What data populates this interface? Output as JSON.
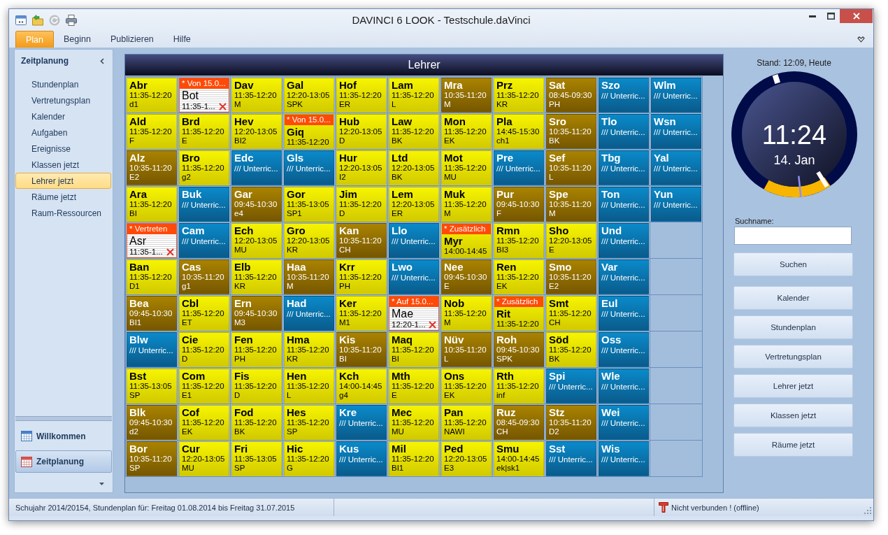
{
  "window": {
    "title": "DAVINCI 6 LOOK - Testschule.daVinci"
  },
  "quick_access": [
    {
      "kind": "window",
      "disabled": false
    },
    {
      "kind": "folder",
      "disabled": false
    },
    {
      "kind": "refresh",
      "disabled": true
    },
    {
      "kind": "printer",
      "disabled": false
    }
  ],
  "ribbon_tabs": [
    {
      "label": "Plan",
      "selected": true
    },
    {
      "label": "Beginn",
      "selected": false
    },
    {
      "label": "Publizieren",
      "selected": false
    },
    {
      "label": "Hilfe",
      "selected": false
    }
  ],
  "sidebar": {
    "title": "Zeitplanung",
    "items": [
      {
        "label": "Stundenplan",
        "selected": false
      },
      {
        "label": "Vertretungsplan",
        "selected": false
      },
      {
        "label": "Kalender",
        "selected": false
      },
      {
        "label": "Aufgaben",
        "selected": false
      },
      {
        "label": "Ereignisse",
        "selected": false
      },
      {
        "label": "Klassen jetzt",
        "selected": false
      },
      {
        "label": "Lehrer jetzt",
        "selected": true
      },
      {
        "label": "Räume jetzt",
        "selected": false
      },
      {
        "label": "Raum-Ressourcen",
        "selected": false
      }
    ],
    "nav_buttons": [
      {
        "kind": "calendar",
        "label": "Willkommen",
        "selected": false
      },
      {
        "kind": "timetable",
        "label": "Zeitplanung",
        "selected": true
      }
    ]
  },
  "board": {
    "title": "Lehrer",
    "rows": [
      [
        {
          "kind": "lesson",
          "name": "Abr",
          "time": "11:35-12:20",
          "subject": "d1"
        },
        {
          "kind": "cancelled",
          "banner": "* Von 15.0...",
          "name": "Bot",
          "time": "11:35-1..."
        },
        {
          "kind": "lesson",
          "name": "Dav",
          "time": "11:35-12:20",
          "subject": "M"
        },
        {
          "kind": "lesson",
          "name": "Gal",
          "time": "12:20-13:05",
          "subject": "SPK"
        },
        {
          "kind": "lesson",
          "name": "Hof",
          "time": "11:35-12:20",
          "subject": "ER"
        },
        {
          "kind": "lesson",
          "name": "Lam",
          "time": "11:35-12:20",
          "subject": "L"
        },
        {
          "kind": "past",
          "name": "Mra",
          "time": "10:35-11:20",
          "subject": "M"
        },
        {
          "kind": "lesson",
          "name": "Prz",
          "time": "11:35-12:20",
          "subject": "KR"
        },
        {
          "kind": "past",
          "name": "Sat",
          "time": "08:45-09:30",
          "subject": "PH"
        },
        {
          "kind": "free",
          "name": "Szo",
          "note": "/// Unterric..."
        },
        {
          "kind": "free",
          "name": "Wlm",
          "note": "/// Unterric..."
        }
      ],
      [
        {
          "kind": "lesson",
          "name": "Ald",
          "time": "11:35-12:20",
          "subject": "F"
        },
        {
          "kind": "lesson",
          "name": "Brd",
          "time": "11:35-12:20",
          "subject": "E"
        },
        {
          "kind": "lesson",
          "name": "Hev",
          "time": "12:20-13:05",
          "subject": "BI2"
        },
        {
          "kind": "lesson",
          "banner": "* Von 15.0...",
          "name": "Giq",
          "time": "11:35-12:20"
        },
        {
          "kind": "lesson",
          "name": "Hub",
          "time": "12:20-13:05",
          "subject": "D"
        },
        {
          "kind": "lesson",
          "name": "Law",
          "time": "11:35-12:20",
          "subject": "BK"
        },
        {
          "kind": "lesson",
          "name": "Mon",
          "time": "11:35-12:20",
          "subject": "EK"
        },
        {
          "kind": "lesson",
          "name": "Pla",
          "time": "14:45-15:30",
          "subject": "ch1"
        },
        {
          "kind": "past",
          "name": "Sro",
          "time": "10:35-11:20",
          "subject": "BK"
        },
        {
          "kind": "free",
          "name": "Tlo",
          "note": "/// Unterric..."
        },
        {
          "kind": "free",
          "name": "Wsn",
          "note": "/// Unterric..."
        }
      ],
      [
        {
          "kind": "past",
          "name": "Alz",
          "time": "10:35-11:20",
          "subject": "E2"
        },
        {
          "kind": "lesson",
          "name": "Bro",
          "time": "11:35-12:20",
          "subject": "g2"
        },
        {
          "kind": "free",
          "name": "Edc",
          "note": "/// Unterric..."
        },
        {
          "kind": "free",
          "name": "Gls",
          "note": "/// Unterric..."
        },
        {
          "kind": "lesson",
          "name": "Hur",
          "time": "12:20-13:05",
          "subject": "I2"
        },
        {
          "kind": "lesson",
          "name": "Ltd",
          "time": "12:20-13:05",
          "subject": "BK"
        },
        {
          "kind": "lesson",
          "name": "Mot",
          "time": "11:35-12:20",
          "subject": "MU"
        },
        {
          "kind": "free",
          "name": "Pre",
          "note": "/// Unterric..."
        },
        {
          "kind": "past",
          "name": "Sef",
          "time": "10:35-11:20",
          "subject": "L"
        },
        {
          "kind": "free",
          "name": "Tbg",
          "note": "/// Unterric..."
        },
        {
          "kind": "free",
          "name": "Yal",
          "note": "/// Unterric..."
        }
      ],
      [
        {
          "kind": "lesson",
          "name": "Ara",
          "time": "11:35-12:20",
          "subject": "BI"
        },
        {
          "kind": "free",
          "name": "Buk",
          "note": "/// Unterric..."
        },
        {
          "kind": "past",
          "name": "Gar",
          "time": "09:45-10:30",
          "subject": "e4"
        },
        {
          "kind": "lesson",
          "name": "Gor",
          "time": "11:35-13:05",
          "subject": "SP1"
        },
        {
          "kind": "lesson",
          "name": "Jim",
          "time": "11:35-12:20",
          "subject": "D"
        },
        {
          "kind": "lesson",
          "name": "Lem",
          "time": "12:20-13:05",
          "subject": "ER"
        },
        {
          "kind": "lesson",
          "name": "Muk",
          "time": "11:35-12:20",
          "subject": "M"
        },
        {
          "kind": "past",
          "name": "Pur",
          "time": "09:45-10:30",
          "subject": "F"
        },
        {
          "kind": "past",
          "name": "Spe",
          "time": "10:35-11:20",
          "subject": "M"
        },
        {
          "kind": "free",
          "name": "Ton",
          "note": "/// Unterric..."
        },
        {
          "kind": "free",
          "name": "Yun",
          "note": "/// Unterric..."
        }
      ],
      [
        {
          "kind": "cancelled",
          "banner": "* Vertreten",
          "name": "Asr",
          "time": "11:35-1..."
        },
        {
          "kind": "free",
          "name": "Cam",
          "note": "/// Unterric..."
        },
        {
          "kind": "lesson",
          "name": "Ech",
          "time": "12:20-13:05",
          "subject": "MU"
        },
        {
          "kind": "lesson",
          "name": "Gro",
          "time": "12:20-13:05",
          "subject": "KR"
        },
        {
          "kind": "past",
          "name": "Kan",
          "time": "10:35-11:20",
          "subject": "CH"
        },
        {
          "kind": "free",
          "name": "Llo",
          "note": "/// Unterric..."
        },
        {
          "kind": "lesson",
          "banner": "* Zusätzlich",
          "name": "Myr",
          "time": "14:00-14:45"
        },
        {
          "kind": "lesson",
          "name": "Rmn",
          "time": "11:35-12:20",
          "subject": "BI3"
        },
        {
          "kind": "lesson",
          "name": "Sho",
          "time": "12:20-13:05",
          "subject": "E"
        },
        {
          "kind": "free",
          "name": "Und",
          "note": "/// Unterric..."
        }
      ],
      [
        {
          "kind": "lesson",
          "name": "Ban",
          "time": "11:35-12:20",
          "subject": "D1"
        },
        {
          "kind": "past",
          "name": "Cas",
          "time": "10:35-11:20",
          "subject": "g1"
        },
        {
          "kind": "lesson",
          "name": "Elb",
          "time": "11:35-12:20",
          "subject": "KR"
        },
        {
          "kind": "past",
          "name": "Haa",
          "time": "10:35-11:20",
          "subject": "M"
        },
        {
          "kind": "lesson",
          "name": "Krr",
          "time": "11:35-12:20",
          "subject": "PH"
        },
        {
          "kind": "free",
          "name": "Lwo",
          "note": "/// Unterric..."
        },
        {
          "kind": "past",
          "name": "Nee",
          "time": "09:45-10:30",
          "subject": "E"
        },
        {
          "kind": "lesson",
          "name": "Ren",
          "time": "11:35-12:20",
          "subject": "EK"
        },
        {
          "kind": "past",
          "name": "Smo",
          "time": "10:35-11:20",
          "subject": "E2"
        },
        {
          "kind": "free",
          "name": "Var",
          "note": "/// Unterric..."
        }
      ],
      [
        {
          "kind": "past",
          "name": "Bea",
          "time": "09:45-10:30",
          "subject": "BI1"
        },
        {
          "kind": "lesson",
          "name": "Cbl",
          "time": "11:35-12:20",
          "subject": "ET"
        },
        {
          "kind": "past",
          "name": "Ern",
          "time": "09:45-10:30",
          "subject": "M3"
        },
        {
          "kind": "free",
          "name": "Had",
          "note": "/// Unterric..."
        },
        {
          "kind": "lesson",
          "name": "Ker",
          "time": "11:35-12:20",
          "subject": "M1"
        },
        {
          "kind": "cancelled",
          "banner": "* Auf 15.0...",
          "name": "Mae",
          "time": "12:20-1..."
        },
        {
          "kind": "lesson",
          "name": "Nob",
          "time": "11:35-12:20",
          "subject": "M"
        },
        {
          "kind": "lesson",
          "banner": "* Zusätzlich",
          "name": "Rit",
          "time": "11:35-12:20"
        },
        {
          "kind": "lesson",
          "name": "Smt",
          "time": "11:35-12:20",
          "subject": "CH"
        },
        {
          "kind": "free",
          "name": "Eul",
          "note": "/// Unterric..."
        }
      ],
      [
        {
          "kind": "free",
          "name": "Blw",
          "note": "/// Unterric..."
        },
        {
          "kind": "lesson",
          "name": "Cie",
          "time": "11:35-12:20",
          "subject": "D"
        },
        {
          "kind": "lesson",
          "name": "Fen",
          "time": "11:35-12:20",
          "subject": "PH"
        },
        {
          "kind": "lesson",
          "name": "Hma",
          "time": "11:35-12:20",
          "subject": "KR"
        },
        {
          "kind": "past",
          "name": "Kis",
          "time": "10:35-11:20",
          "subject": "BI"
        },
        {
          "kind": "lesson",
          "name": "Maq",
          "time": "11:35-12:20",
          "subject": "BI"
        },
        {
          "kind": "past",
          "name": "Nüv",
          "time": "10:35-11:20",
          "subject": "L"
        },
        {
          "kind": "past",
          "name": "Roh",
          "time": "09:45-10:30",
          "subject": "SPK"
        },
        {
          "kind": "lesson",
          "name": "Söd",
          "time": "11:35-12:20",
          "subject": "BK"
        },
        {
          "kind": "free",
          "name": "Oss",
          "note": "/// Unterric..."
        }
      ],
      [
        {
          "kind": "lesson",
          "name": "Bst",
          "time": "11:35-13:05",
          "subject": "SP"
        },
        {
          "kind": "lesson",
          "name": "Com",
          "time": "11:35-12:20",
          "subject": "E1"
        },
        {
          "kind": "lesson",
          "name": "Fis",
          "time": "11:35-12:20",
          "subject": "D"
        },
        {
          "kind": "lesson",
          "name": "Hen",
          "time": "11:35-12:20",
          "subject": "L"
        },
        {
          "kind": "lesson",
          "name": "Kch",
          "time": "14:00-14:45",
          "subject": "g4"
        },
        {
          "kind": "lesson",
          "name": "Mth",
          "time": "11:35-12:20",
          "subject": "E"
        },
        {
          "kind": "lesson",
          "name": "Ons",
          "time": "11:35-12:20",
          "subject": "EK"
        },
        {
          "kind": "lesson",
          "name": "Rth",
          "time": "11:35-12:20",
          "subject": "inf"
        },
        {
          "kind": "free",
          "name": "Spi",
          "note": "/// Unterric..."
        },
        {
          "kind": "free",
          "name": "Wle",
          "note": "/// Unterric..."
        }
      ],
      [
        {
          "kind": "past",
          "name": "Blk",
          "time": "09:45-10:30",
          "subject": "d2"
        },
        {
          "kind": "lesson",
          "name": "Cof",
          "time": "11:35-12:20",
          "subject": "EK"
        },
        {
          "kind": "lesson",
          "name": "Fod",
          "time": "11:35-12:20",
          "subject": "BK"
        },
        {
          "kind": "lesson",
          "name": "Hes",
          "time": "11:35-12:20",
          "subject": "SP"
        },
        {
          "kind": "free",
          "name": "Kre",
          "note": "/// Unterric..."
        },
        {
          "kind": "lesson",
          "name": "Mec",
          "time": "11:35-12:20",
          "subject": "MU"
        },
        {
          "kind": "lesson",
          "name": "Pan",
          "time": "11:35-12:20",
          "subject": "NAWI"
        },
        {
          "kind": "past",
          "name": "Ruz",
          "time": "08:45-09:30",
          "subject": "CH"
        },
        {
          "kind": "past",
          "name": "Stz",
          "time": "10:35-11:20",
          "subject": "D2"
        },
        {
          "kind": "free",
          "name": "Wei",
          "note": "/// Unterric..."
        }
      ],
      [
        {
          "kind": "past",
          "name": "Bor",
          "time": "10:35-11:20",
          "subject": "SP"
        },
        {
          "kind": "lesson",
          "name": "Cur",
          "time": "12:20-13:05",
          "subject": "MU"
        },
        {
          "kind": "lesson",
          "name": "Fri",
          "time": "11:35-13:05",
          "subject": "SP"
        },
        {
          "kind": "lesson",
          "name": "Hic",
          "time": "11:35-12:20",
          "subject": "G"
        },
        {
          "kind": "free",
          "name": "Kus",
          "note": "/// Unterric..."
        },
        {
          "kind": "lesson",
          "name": "Mil",
          "time": "11:35-12:20",
          "subject": "BI1"
        },
        {
          "kind": "lesson",
          "name": "Ped",
          "time": "12:20-13:05",
          "subject": "E3"
        },
        {
          "kind": "lesson",
          "name": "Smu",
          "time": "14:00-14:45",
          "subject": "ek|sk1"
        },
        {
          "kind": "free",
          "name": "Sst",
          "note": "/// Unterric..."
        },
        {
          "kind": "free",
          "name": "Wis",
          "note": "/// Unterric..."
        }
      ]
    ]
  },
  "clock_panel": {
    "stand": "Stand: 12:09, Heute",
    "time": "11:24",
    "date": "14. Jan",
    "search_label": "Suchname:",
    "search_button": "Suchen",
    "buttons": [
      "Kalender",
      "Stundenplan",
      "Vertretungsplan",
      "Lehrer jetzt",
      "Klassen jetzt",
      "Räume jetzt"
    ]
  },
  "status_bar": {
    "info": "Schujahr 2014/20154, Stundenplan für: Freitag 01.08.2014 bis Freitag 31.07.2015",
    "connection": "Nicht verbunden ! (offline)"
  }
}
